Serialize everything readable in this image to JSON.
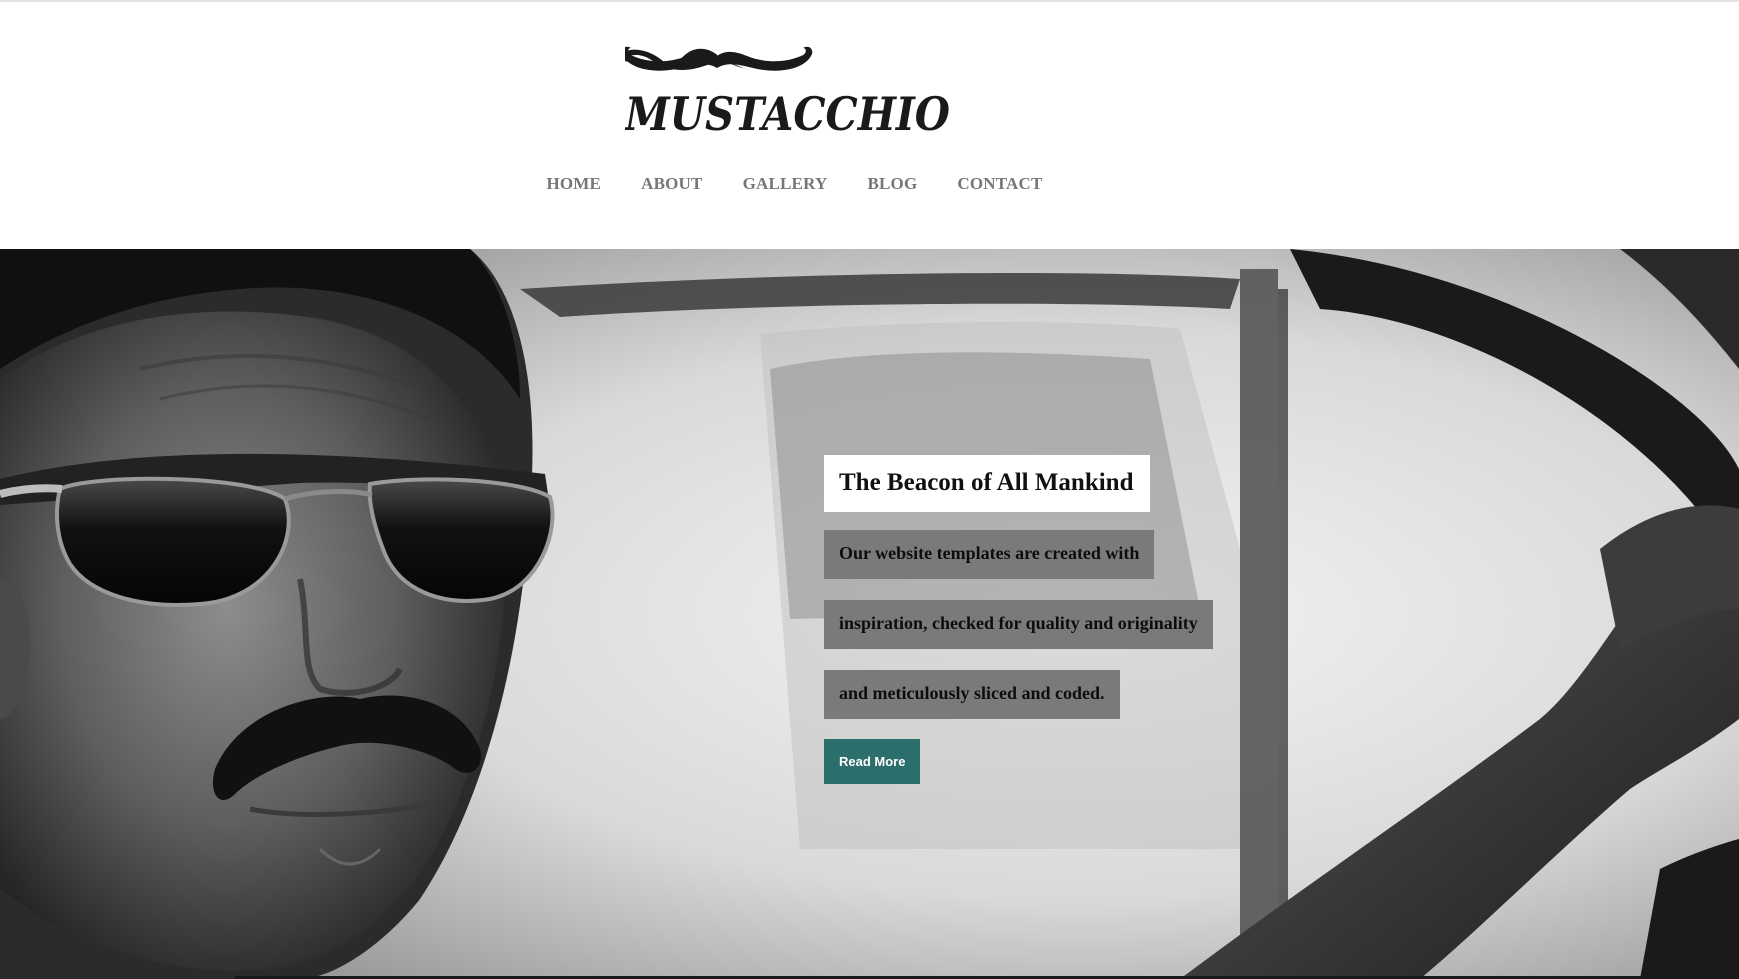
{
  "header": {
    "logo_text": "MUSTACCHIO"
  },
  "nav": {
    "items": [
      {
        "label": "HOME"
      },
      {
        "label": "ABOUT"
      },
      {
        "label": "GALLERY"
      },
      {
        "label": "BLOG"
      },
      {
        "label": "CONTACT"
      }
    ]
  },
  "hero": {
    "title": "The Beacon of All Mankind",
    "lines": [
      "Our website templates are created with",
      "inspiration, checked for quality and originality",
      "and meticulously sliced and coded."
    ],
    "button_label": "Read More"
  },
  "colors": {
    "nav_text": "#777777",
    "caption_bg": "#7a7a7a",
    "button_bg": "#2c6e6b",
    "title_bg": "#ffffff"
  },
  "icons": {
    "logo": "mustache-logo",
    "hero": "man-with-sunglasses-in-car-photo"
  }
}
